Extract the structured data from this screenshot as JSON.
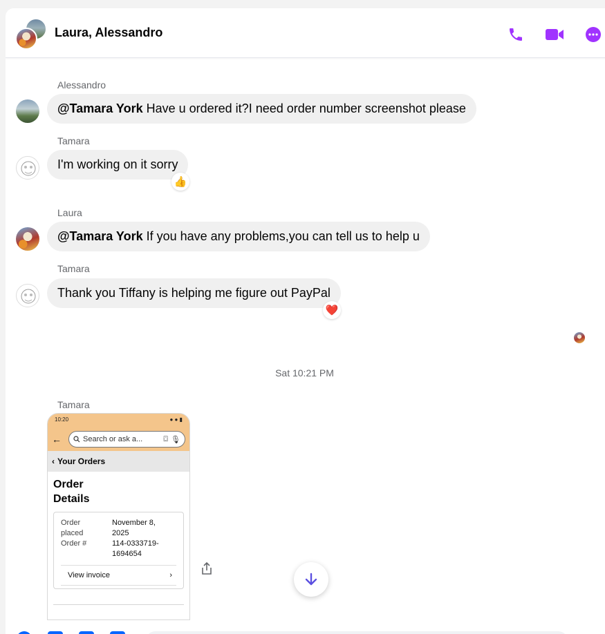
{
  "header": {
    "title": "Laura, Alessandro",
    "accent_color": "#a033ff",
    "actions": [
      {
        "name": "audio-call-icon"
      },
      {
        "name": "video-call-icon"
      },
      {
        "name": "more-options-icon"
      }
    ]
  },
  "messages": [
    {
      "sender": "Alessandro",
      "mention": "@Tamara York",
      "text": " Have u ordered it?I need order number screenshot please"
    },
    {
      "sender": "Tamara",
      "mention": "",
      "text": "I'm working on it sorry",
      "reaction": "👍"
    },
    {
      "sender": "Laura",
      "mention": "@Tamara York",
      "text": " If you have any problems,you can tell us to help u"
    },
    {
      "sender": "Tamara",
      "mention": "",
      "text": "Thank you Tiffany is helping me figure out PayPal",
      "reaction": "❤️"
    }
  ],
  "timestamp": "Sat 10:21 PM",
  "attachment": {
    "sender": "Tamara",
    "status_time": "10:20",
    "search_placeholder": "Search or ask a...",
    "orders_link": "Your Orders",
    "title_line1": "Order",
    "title_line2": "Details",
    "rows": [
      {
        "label": "Order",
        "value": "November 8,"
      },
      {
        "label": "placed",
        "value": "2025"
      },
      {
        "label": "Order #",
        "value": "114-0333719-"
      },
      {
        "label": "",
        "value": "1694654"
      }
    ],
    "invoice_label": "View invoice"
  },
  "colors": {
    "bubble_bg": "#f0f0f0",
    "meta_text": "#65676b",
    "scroll_arrow": "#5b4fe0"
  }
}
